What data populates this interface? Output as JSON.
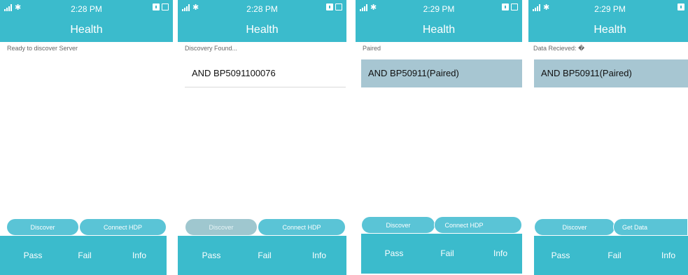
{
  "colors": {
    "accent": "#3bbbcc",
    "button": "#5ac4d6",
    "paired_row": "#a7c6d2"
  },
  "screens": [
    {
      "time": "2:28 PM",
      "title": "Health",
      "status_text": "Ready to discover Server",
      "device": null,
      "buttons": {
        "left": "Discover",
        "right": "Connect HDP"
      },
      "tabs": [
        "Pass",
        "Fail",
        "Info"
      ]
    },
    {
      "time": "2:28 PM",
      "title": "Health",
      "status_text": "Discovery Found...",
      "device": "AND BP5091100076",
      "buttons": {
        "left": "Discover",
        "right": "Connect HDP"
      },
      "tabs": [
        "Pass",
        "Fail",
        "Info"
      ]
    },
    {
      "time": "2:29 PM",
      "title": "Health",
      "status_text": "Paired",
      "device": "AND BP50911(Paired)",
      "buttons": {
        "left": "Discover",
        "right": "Connect HDP"
      },
      "tabs": [
        "Pass",
        "Fail",
        "Info"
      ]
    },
    {
      "time": "2:29 PM",
      "title": "Health",
      "status_text": "Data Recieved: �",
      "device": "AND BP50911(Paired)",
      "buttons": {
        "left": "Discover",
        "right": "Get Data"
      },
      "tabs": [
        "Pass",
        "Fail",
        "Info"
      ]
    }
  ]
}
